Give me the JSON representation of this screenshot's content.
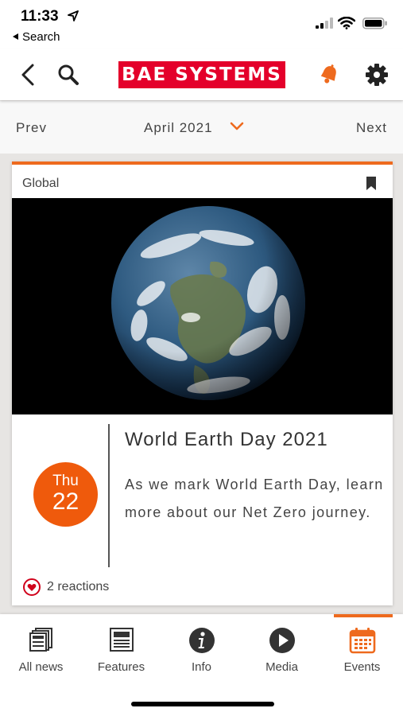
{
  "status_bar": {
    "time": "11:33",
    "back_label": "Search"
  },
  "header": {
    "brand": "BAE SYSTEMS",
    "icons": [
      "back-icon",
      "search-icon",
      "bell-icon",
      "gear-icon"
    ],
    "accent_color": "#ee6a1e",
    "brand_color": "#e4002b"
  },
  "month_nav": {
    "prev_label": "Prev",
    "month": "April 2021",
    "next_label": "Next"
  },
  "card": {
    "category": "Global",
    "date_dow": "Thu",
    "date_day": "22",
    "title": "World Earth Day 2021",
    "description": "As we mark World Earth Day, learn more about our Net Zero journey.",
    "reactions": "2 reactions"
  },
  "tabs": [
    {
      "label": "All news",
      "icon": "newspaper-icon"
    },
    {
      "label": "Features",
      "icon": "features-icon"
    },
    {
      "label": "Info",
      "icon": "info-icon"
    },
    {
      "label": "Media",
      "icon": "play-icon"
    },
    {
      "label": "Events",
      "icon": "calendar-icon"
    }
  ],
  "active_tab": "Events"
}
